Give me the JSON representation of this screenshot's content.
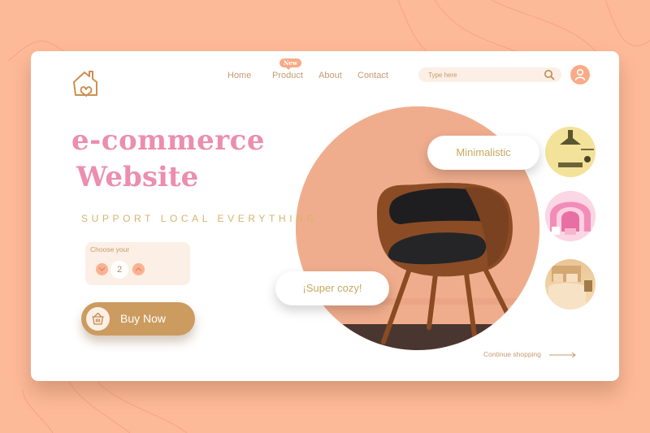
{
  "header": {
    "logo": "home-heart-logo",
    "nav": [
      {
        "label": "Home"
      },
      {
        "label": "Product",
        "badge": "New"
      },
      {
        "label": "About"
      },
      {
        "label": "Contact"
      }
    ],
    "search": {
      "placeholder": "Type here",
      "value": ""
    },
    "avatar_icon": "user-icon"
  },
  "hero": {
    "title_line1": "e-commerce",
    "title_line2": "Website",
    "tagline": "SUPPORT LOCAL EVERYTHING"
  },
  "quantity": {
    "label": "Choose your",
    "value": "2"
  },
  "buy_button": {
    "label": "Buy Now",
    "icon": "basket-icon"
  },
  "chips": {
    "minimalistic": "Minimalistic",
    "cozy": "¡Super cozy!"
  },
  "thumbnails": [
    {
      "name": "kitchen"
    },
    {
      "name": "pink-room"
    },
    {
      "name": "bedroom"
    }
  ],
  "continue_link": "Continue shopping",
  "colors": {
    "background": "#fdba99",
    "accent_pink": "#ec8eae",
    "accent_gold": "#cc9b5f",
    "accent_peach": "#f9ab88",
    "text_tan": "#c79a70"
  }
}
